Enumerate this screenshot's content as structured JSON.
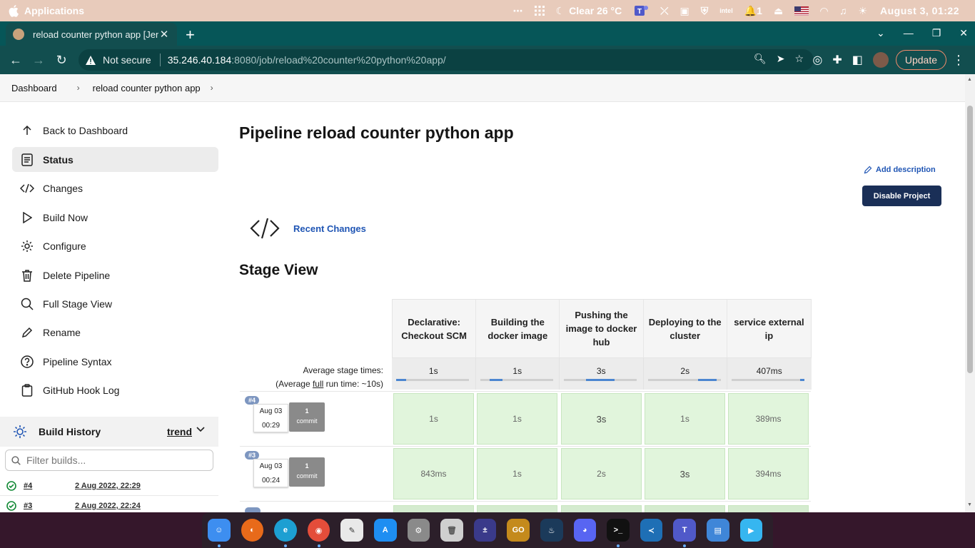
{
  "os_bar": {
    "apps_label": "Applications",
    "weather": "Clear 26 °C",
    "notif_count": "1",
    "clock": "August  3, 01:22"
  },
  "browser": {
    "tab_title": "reload counter python app [Jen",
    "url_warning": "Not secure",
    "url_host": "35.246.40.184",
    "url_path": ":8080/job/reload%20counter%20python%20app/",
    "update_label": "Update"
  },
  "breadcrumb": {
    "items": [
      "Dashboard",
      "reload counter python app"
    ]
  },
  "sidebar": {
    "items": [
      {
        "label": "Back to Dashboard",
        "icon": "arrow-up-icon"
      },
      {
        "label": "Status",
        "icon": "document-icon"
      },
      {
        "label": "Changes",
        "icon": "code-icon"
      },
      {
        "label": "Build Now",
        "icon": "play-icon"
      },
      {
        "label": "Configure",
        "icon": "gear-icon"
      },
      {
        "label": "Delete Pipeline",
        "icon": "trash-icon"
      },
      {
        "label": "Full Stage View",
        "icon": "search-icon"
      },
      {
        "label": "Rename",
        "icon": "pencil-icon"
      },
      {
        "label": "Pipeline Syntax",
        "icon": "help-icon"
      },
      {
        "label": "GitHub Hook Log",
        "icon": "clipboard-icon"
      }
    ]
  },
  "build_history": {
    "title": "Build History",
    "trend_label": "trend",
    "filter_placeholder": "Filter builds...",
    "builds": [
      {
        "number": "#4",
        "date": "2 Aug 2022, 22:29"
      },
      {
        "number": "#3",
        "date": "2 Aug 2022, 22:24"
      }
    ]
  },
  "main": {
    "title": "Pipeline reload counter python app",
    "add_description": "Add description",
    "disable_project": "Disable Project",
    "recent_changes": "Recent Changes",
    "stage_view_title": "Stage View"
  },
  "stage_view": {
    "stages": [
      "Declarative: Checkout SCM",
      "Building the docker image",
      "Pushing the image to docker hub",
      "Deploying to the cluster",
      "service external ip"
    ],
    "avg_label_line1": "Average stage times:",
    "avg_label_line2_pre": "(Average ",
    "avg_label_line2_u": "full",
    "avg_label_line2_post": " run time: ~10s)",
    "avg_times": [
      "1s",
      "1s",
      "3s",
      "2s",
      "407ms"
    ],
    "runs": [
      {
        "badge": "#4",
        "month_day": "Aug 03",
        "time": "00:29",
        "commit_count": "1",
        "commit_label": "commit",
        "times": [
          "1s",
          "1s",
          "3s",
          "1s",
          "389ms"
        ]
      },
      {
        "badge": "#3",
        "month_day": "Aug 03",
        "time": "00:24",
        "commit_count": "1",
        "commit_label": "commit",
        "times": [
          "843ms",
          "1s",
          "2s",
          "3s",
          "394ms"
        ]
      }
    ]
  },
  "dock": {
    "apps": [
      "Finder",
      "Firefox",
      "Edge",
      "Chrome",
      "TextEdit",
      "App Store",
      "System Preferences",
      "Trash",
      "Calculator",
      "CS:GO",
      "Steam",
      "Discord",
      "Terminal",
      "VS Code",
      "Teams",
      "Files",
      "Player"
    ]
  },
  "colors": {
    "os_bar": "#e8cbbb",
    "browser_tab": "#124e4f",
    "jenkins_button": "#1a2f57",
    "stage_success": "#e1f5dc",
    "link": "#1f55b4"
  }
}
